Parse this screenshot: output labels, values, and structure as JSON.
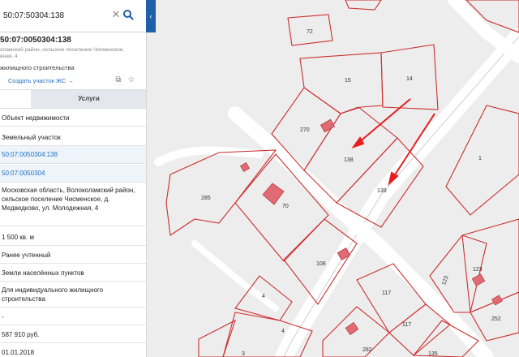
{
  "search": {
    "value": "50:07:50304:138"
  },
  "parcel": {
    "cadastral_number": "50:07:0050304:138",
    "address_small": "оламский район, сельское поселение Чисменское,\nеная, 4",
    "purpose_small": "жилищного строительства",
    "create_link": "Создать участок ЖС →"
  },
  "tabs": {
    "services": "Услуги"
  },
  "details": [
    {
      "text": "Объект недвижимости",
      "link": false
    },
    {
      "text": "Земельный участок",
      "link": false
    },
    {
      "text": "50:07:0050304:138",
      "link": true
    },
    {
      "text": "50:07:0050304",
      "link": true
    },
    {
      "text": "Московская область, Волоколамский район, сельское поселение Чисменское, д. Медведково, ул. Молодежная, 4",
      "link": false
    },
    {
      "text": "1 500 кв. м",
      "link": false
    },
    {
      "text": "Ранее учтенный",
      "link": false
    },
    {
      "text": "Земли населённых пунктов",
      "link": false
    },
    {
      "text": "Для индивидуального жилищного строительства",
      "link": false
    },
    {
      "text": "-",
      "link": false
    },
    {
      "text": "587 910 руб.",
      "link": false
    },
    {
      "text": "01.01.2018",
      "link": false
    }
  ],
  "map": {
    "plot_labels": [
      "72",
      "15",
      "14",
      "270",
      "138",
      "139",
      "1",
      "285",
      "70",
      "108",
      "4",
      "4",
      "3",
      "117",
      "117",
      "282",
      "135",
      "123",
      "123",
      "252"
    ],
    "parcel_color": "#cc2f2f",
    "building_color": "#e06b74"
  }
}
